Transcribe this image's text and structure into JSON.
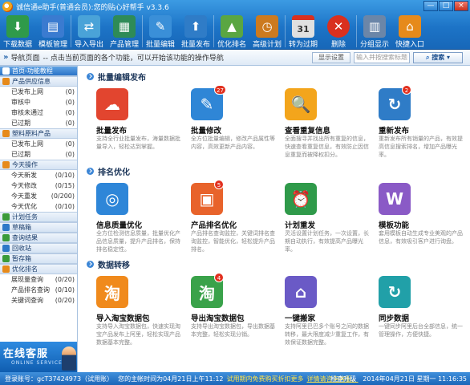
{
  "app": {
    "title": "诚信通e助手(普通会员):您的贴心好帮手 v3.3.6"
  },
  "window_buttons": [
    "—",
    "□",
    "×"
  ],
  "toolbar": [
    {
      "label": "下载数据",
      "icon": "download-icon",
      "color": "#2f9a4a",
      "glyph": "⬇"
    },
    {
      "label": "模板管理",
      "icon": "template-icon",
      "color": "#3a7bd0",
      "glyph": "▤"
    },
    {
      "label": "导入导出",
      "icon": "import-export-icon",
      "color": "#4aa3d8",
      "glyph": "⇄"
    },
    {
      "label": "产品管理",
      "icon": "product-icon",
      "color": "#2e8b57",
      "glyph": "▦"
    },
    {
      "label": "批量编辑",
      "icon": "batch-edit-icon",
      "color": "#3a8fd8",
      "glyph": "✎"
    },
    {
      "label": "批量发布",
      "icon": "batch-publish-icon",
      "color": "#2f7cc7",
      "glyph": "⬆"
    },
    {
      "label": "优化排名",
      "icon": "rank-icon",
      "color": "#5aa642",
      "glyph": "▲"
    },
    {
      "label": "高级计划",
      "icon": "plan-icon",
      "color": "#cc7a1f",
      "glyph": "◷"
    },
    {
      "label": "转为过期",
      "icon": "calendar-icon",
      "color": "#e0e0e0",
      "glyph": "31"
    },
    {
      "label": "删除",
      "icon": "delete-icon",
      "color": "#d9301f",
      "glyph": "✕"
    },
    {
      "label": "分组显示",
      "icon": "group-icon",
      "color": "#6b86a8",
      "glyph": "▥"
    },
    {
      "label": "快捷入口",
      "icon": "home-icon",
      "color": "#e68a1b",
      "glyph": "⌂"
    }
  ],
  "nav": {
    "page": "导航页面",
    "hint": "-- 点击当前页面的各个功能，可以开始该功能的操作导航",
    "settings": "显示设置",
    "search_placeholder": "输入并按搜索标题",
    "search_button": "搜索"
  },
  "sidebar": {
    "home": "首页-功能教程",
    "groups": [
      {
        "title": "产品供应信息",
        "items": [
          {
            "label": "已发布上网",
            "count": "(0)"
          },
          {
            "label": "审核中",
            "count": "(0)"
          },
          {
            "label": "审核未通过",
            "count": "(0)"
          },
          {
            "label": "已过期",
            "count": "(0)"
          }
        ]
      },
      {
        "title": "塑料原料产品",
        "items": [
          {
            "label": "已发布上网",
            "count": "(0)"
          },
          {
            "label": "已过期",
            "count": "(0)"
          }
        ]
      },
      {
        "title": "今天操作",
        "items": [
          {
            "label": "今天新发",
            "count": "(0/10)"
          },
          {
            "label": "今天修改",
            "count": "(0/15)"
          },
          {
            "label": "今天重发",
            "count": "(0/200)"
          },
          {
            "label": "今天优化",
            "count": "(0/10)"
          }
        ]
      }
    ],
    "sections": [
      "计划任务",
      "草稿箱",
      "查询结果",
      "回收站",
      "暂存箱"
    ],
    "optimize": {
      "title": "优化排名",
      "items": [
        {
          "label": "展现量查询",
          "count": "(0/20)"
        },
        {
          "label": "产品排名查询",
          "count": "(0/10)"
        },
        {
          "label": "关键词查询",
          "count": "(0/20)"
        }
      ]
    },
    "online": {
      "main": "在线客服",
      "sub": "ONLINE SERVICE"
    }
  },
  "sections": [
    {
      "title": "批量编辑发布",
      "features": [
        {
          "name": "批量发布",
          "desc": "支持全行业批量发布，海量数据批量导入，轻松达到掌握。",
          "color": "#e2452f",
          "glyph": "☁",
          "badge": ""
        },
        {
          "name": "批量修改",
          "desc": "全方位批量编辑，修改产品属性等内容，高效更新产品内容。",
          "color": "#2f86d6",
          "glyph": "✎",
          "badge": "27"
        },
        {
          "name": "查看重复信息",
          "desc": "全面搜寻并找出所有重复的信息，快速查看重复信息，有效防止因信息重复而被降权扣分。",
          "color": "#f3a51c",
          "glyph": "🔍",
          "badge": ""
        },
        {
          "name": "重新发布",
          "desc": "重新发布所有销量的产品，有效提高信息搜索排名，增加产品曝光率。",
          "color": "#2f7cc7",
          "glyph": "↻",
          "badge": "2"
        }
      ]
    },
    {
      "title": "排名优化",
      "features": [
        {
          "name": "信息质量优化",
          "desc": "全方位检测信息质量，批量优化产品信息质量，提升产品排名，保持排名稳定性。",
          "color": "#2e86d8",
          "glyph": "◎",
          "badge": ""
        },
        {
          "name": "产品排名优化",
          "desc": "产品排名查询监控，关键词排名查询监控，智能优化，轻松提升产品排名。",
          "color": "#e8632b",
          "glyph": "▣",
          "badge": "5"
        },
        {
          "name": "计划重发",
          "desc": "灵活设置计划任务，一次设置，长期自动执行，有效提高产品曝光率。",
          "color": "#2f9a4a",
          "glyph": "⏰",
          "badge": ""
        },
        {
          "name": "模板功能",
          "desc": "套用模板自动生成专业美观的产品信息，有效吸引客户进行询盘。",
          "color": "#8a5ac6",
          "glyph": "W",
          "badge": ""
        }
      ]
    },
    {
      "title": "数据转移",
      "features": [
        {
          "name": "导入淘宝数据包",
          "desc": "支持导入淘宝数据包，快速实现淘宝产品发布上阿里，轻松实现产品数据基本完整。",
          "color": "#f08a1c",
          "glyph": "淘",
          "badge": ""
        },
        {
          "name": "导出淘宝数据包",
          "desc": "支持导出淘宝数据包，导出数据基本完整，轻松实现分销。",
          "color": "#3aa24a",
          "glyph": "淘",
          "badge": "4"
        },
        {
          "name": "一键搬家",
          "desc": "支持阿里巴巴多个账号之间的数据转移，最大限度减少重复工作，有效保证数据完整。",
          "color": "#6a5ac6",
          "glyph": "⌂",
          "badge": ""
        },
        {
          "name": "同步数据",
          "desc": "一键同步阿里后台全部信息，统一管理操作，方便快捷。",
          "color": "#21a0a8",
          "glyph": "↻",
          "badge": ""
        }
      ]
    }
  ],
  "status": {
    "account": "登录账号：gcT37424973（试用账）",
    "expire": "您的主帐时间为04月21日上午11:12",
    "warning": "试用期内免费购买折扣更多",
    "link": "详情请咨询客服。",
    "upgrade": "检查升级",
    "datetime": "2014年04月21日 星期一 11:16:35"
  }
}
